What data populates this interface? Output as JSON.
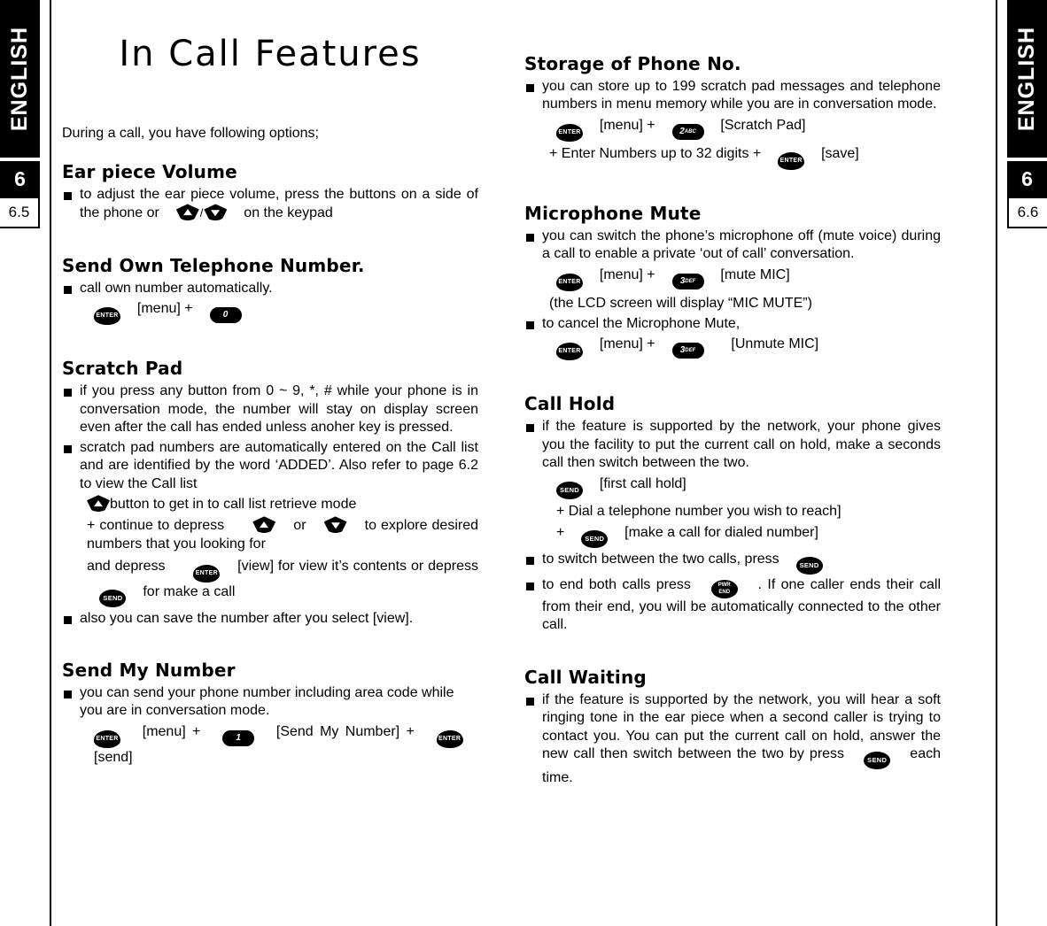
{
  "sidebar": {
    "language": "ENGLISH",
    "chapter": "6",
    "left_page": "6.5",
    "right_page": "6.6"
  },
  "title": "In Call Features",
  "intro": "During a call, you have following options;",
  "keys": {
    "enter": "ENTER",
    "send": "SEND",
    "end_line1": "PWR",
    "end_line2": "END",
    "num0": "0",
    "num1": "1",
    "num2": "2",
    "num2_sub": "ABC",
    "num3": "3",
    "num3_sub": "DEF",
    "nav_down": "down-arrow-key",
    "nav_up": "up-arrow-key"
  },
  "left_column": {
    "sections": [
      {
        "heading": "Ear piece Volume",
        "bullet1_a": "to adjust the ear piece volume, press the buttons on a side of the phone or",
        "bullet1_b": "on the keypad"
      },
      {
        "heading": "Send Own Telephone Number.",
        "bullet1": "call own number automatically.",
        "step_menu": "[menu] +"
      },
      {
        "heading": "Scratch Pad",
        "bullet1": "if you press any button from 0 ~ 9, *, # while your phone is in conversation mode, the number will stay on display screen even after the call has ended unless anoher key is pressed.",
        "bullet2": "scratch pad numbers are automatically entered on the Call list and are identified by the word ‘ADDED’. Also refer to page 6.2 to view the Call list",
        "line_retrieve": "button to get in to call list retrieve mode",
        "line_continue_a": "+ continue to depress",
        "line_continue_or": "or",
        "line_continue_b": "to explore desired numbers that you looking for",
        "line_view_a": "and depress",
        "line_view_b": "[view] for view it’s contents or depress",
        "line_view_c": "for make a call",
        "bullet3": "also you can save the number after you select [view]."
      },
      {
        "heading": "Send My Number",
        "bullet1": "you can send your phone number including area code while you are in conversation mode.",
        "step_a": "[menu] +",
        "step_b": "[Send My Number] +",
        "step_c": "[send]"
      }
    ]
  },
  "right_column": {
    "sections": [
      {
        "heading": "Storage of Phone No.",
        "bullet1": "you can store up to 199 scratch pad messages and telephone numbers in menu memory while you are in conversation mode.",
        "step_a": "[menu] +",
        "step_b": "[Scratch Pad]",
        "step_c": "+ Enter Numbers up to 32 digits +",
        "step_d": "[save]"
      },
      {
        "heading": "Microphone Mute",
        "bullet1": "you can switch the phone’s microphone off (mute voice) during a call to enable a private ‘out of call’ conversation.",
        "step_a": "[menu] +",
        "step_b": "[mute MIC]",
        "note": "(the LCD screen will display “MIC MUTE”)",
        "bullet2": "to cancel the Microphone Mute,",
        "step_c": "[menu] +",
        "step_d": "[Unmute MIC]"
      },
      {
        "heading": "Call Hold",
        "bullet1": "if the feature is supported by the network, your phone gives you the facility to put the current call on hold, make a seconds call then switch between the two.",
        "step_a": "[first call hold]",
        "step_b": "+ Dial a telephone number you wish to reach]",
        "step_plus": "+",
        "step_c": "[make a call for dialed number]",
        "bullet2": "to switch between the two calls, press",
        "bullet3_a": "to end both calls press",
        "bullet3_b": ". If one caller ends their call from their end, you will be automatically connected to the other call."
      },
      {
        "heading": "Call Waiting",
        "bullet1_a": "if the feature is supported by the network, you will hear a soft ringing tone in the ear piece when a second caller is trying to contact you. You can put the current call on hold, answer the new call then switch between the two by press",
        "bullet1_b": "each time."
      }
    ]
  }
}
